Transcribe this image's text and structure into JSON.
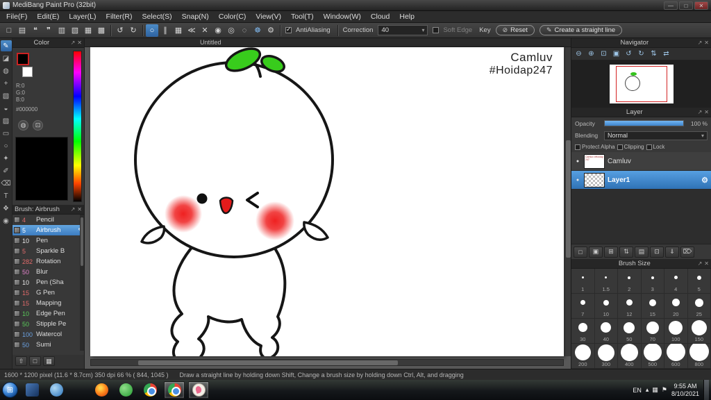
{
  "window": {
    "title": "MediBang Paint Pro (32bit)",
    "minimize": "—",
    "maximize": "□",
    "close": "✕"
  },
  "menubar": [
    "File(F)",
    "Edit(E)",
    "Layer(L)",
    "Filter(R)",
    "Select(S)",
    "Snap(N)",
    "Color(C)",
    "View(V)",
    "Tool(T)",
    "Window(W)",
    "Cloud",
    "Help"
  ],
  "toolbar": {
    "file_icons": [
      {
        "name": "new-canvas-icon",
        "glyph": "□"
      },
      {
        "name": "open-file-icon",
        "glyph": "▤"
      },
      {
        "name": "cloud-upload-icon",
        "glyph": "❝"
      },
      {
        "name": "comment-icon",
        "glyph": "❞"
      },
      {
        "name": "save-icon",
        "glyph": "▥"
      },
      {
        "name": "export-icon",
        "glyph": "▧"
      },
      {
        "name": "resize-canvas-icon",
        "glyph": "▦"
      },
      {
        "name": "crop-canvas-icon",
        "glyph": "▩"
      }
    ],
    "undo_glyph": "↺",
    "redo_glyph": "↻",
    "snap_icons": [
      {
        "name": "freehand-brush-icon",
        "glyph": "○",
        "cls": "selected"
      },
      {
        "name": "snap-parallel-icon",
        "glyph": "∥"
      },
      {
        "name": "snap-grid-icon",
        "glyph": "▦"
      },
      {
        "name": "snap-lines-icon",
        "glyph": "≪"
      },
      {
        "name": "snap-cross-icon",
        "glyph": "✕"
      },
      {
        "name": "snap-vanishing-icon",
        "glyph": "◉"
      },
      {
        "name": "snap-concentric-icon",
        "glyph": "◎"
      },
      {
        "name": "snap-ellipse-icon",
        "glyph": "◌"
      },
      {
        "name": "snap-rotate-icon",
        "glyph": "☸",
        "cls": "blue"
      },
      {
        "name": "snap-settings-icon",
        "glyph": "⚙"
      }
    ],
    "antialiasing_label": "AntiAliasing",
    "correction_label": "Correction",
    "correction_value": "40",
    "dropdown_arrow": "▾",
    "soft_edge_label": "Soft Edge",
    "key_label": "Key",
    "reset_icon": "⊘",
    "reset_label": "Reset",
    "straight_line_icon": "✎",
    "straight_line_label": "Create a straight line"
  },
  "panel_icons": {
    "popout": "↗",
    "close": "✕"
  },
  "tool_strip": [
    {
      "name": "brush-tool-icon",
      "glyph": "✎",
      "cls": "selected"
    },
    {
      "name": "eraser-tool-icon",
      "glyph": "◪"
    },
    {
      "name": "smudge-tool-icon",
      "glyph": "◍"
    },
    {
      "name": "move-tool-icon",
      "glyph": "+"
    },
    {
      "name": "fill-tool-icon",
      "glyph": "▧"
    },
    {
      "name": "bucket-tool-icon",
      "glyph": "◒"
    },
    {
      "name": "gradient-tool-icon",
      "glyph": "▨"
    },
    {
      "name": "select-tool-icon",
      "glyph": "▭"
    },
    {
      "name": "lasso-tool-icon",
      "glyph": "○"
    },
    {
      "name": "magic-wand-tool-icon",
      "glyph": "✦"
    },
    {
      "name": "select-pen-tool-icon",
      "glyph": "✐"
    },
    {
      "name": "select-eraser-tool-icon",
      "glyph": "⌫"
    },
    {
      "name": "text-tool-icon",
      "glyph": "T"
    },
    {
      "name": "pan-tool-icon",
      "glyph": "❖"
    },
    {
      "name": "eyedropper-tool-icon",
      "glyph": "◉"
    }
  ],
  "color_panel": {
    "title": "Color",
    "r_label": "R:0",
    "g_label": "G:0",
    "b_label": "B:0",
    "hex_value": "#000000",
    "wheel_icon": "◍",
    "palette_icon": "⊡"
  },
  "brush_panel": {
    "title": "Brush: Airbrush",
    "brushes": [
      {
        "size": "4",
        "name": "Pencil",
        "color": "#e06a6a"
      },
      {
        "size": "5",
        "name": "Airbrush",
        "color": "#ffffff",
        "cls": "selected",
        "edit": "✎"
      },
      {
        "size": "10",
        "name": "Pen",
        "color": "#e8e8e8"
      },
      {
        "size": "5",
        "name": "Sparkle B",
        "color": "#e06a6a"
      },
      {
        "size": "282",
        "name": "Rotation",
        "color": "#e06a6a"
      },
      {
        "size": "50",
        "name": "Blur",
        "color": "#e080c8"
      },
      {
        "size": "10",
        "name": "Pen (Sha",
        "color": "#e8e8e8"
      },
      {
        "size": "15",
        "name": "G Pen",
        "color": "#e06a6a"
      },
      {
        "size": "15",
        "name": "Mapping",
        "color": "#e06a6a"
      },
      {
        "size": "10",
        "name": "Edge Pen",
        "color": "#58c858"
      },
      {
        "size": "50",
        "name": "Stipple Pe",
        "color": "#58c858"
      },
      {
        "size": "100",
        "name": "Watercol",
        "color": "#6aa0e0"
      },
      {
        "size": "50",
        "name": "Sumi",
        "color": "#6aa0e0"
      }
    ]
  },
  "brush_footer_icons": [
    {
      "name": "sync-brushes-icon",
      "glyph": "⇧"
    },
    {
      "name": "add-brush-icon",
      "glyph": "□"
    },
    {
      "name": "brush-settings-icon",
      "glyph": "▦"
    }
  ],
  "canvas": {
    "tab_title": "Untitled",
    "signature_line1": "Camluv",
    "signature_line2": "#Hoidap247"
  },
  "navigator": {
    "title": "Navigator",
    "icons": [
      {
        "name": "zoom-out-icon",
        "glyph": "⊖"
      },
      {
        "name": "zoom-in-icon",
        "glyph": "⊕"
      },
      {
        "name": "fit-window-icon",
        "glyph": "⊡"
      },
      {
        "name": "actual-pixels-icon",
        "glyph": "▣"
      },
      {
        "name": "rotate-left-icon",
        "glyph": "↺"
      },
      {
        "name": "rotate-right-icon",
        "glyph": "↻"
      },
      {
        "name": "reset-rotation-icon",
        "glyph": "⇅"
      },
      {
        "name": "flip-horizontal-icon",
        "glyph": "⇄"
      }
    ]
  },
  "layer_panel": {
    "title": "Layer",
    "opacity_label": "Opacity",
    "opacity_value": "100 %",
    "blending_label": "Blending",
    "blending_value": "Normal",
    "dropdown_arrow": "▾",
    "protect_alpha_label": "Protect Alpha",
    "clipping_label": "Clipping",
    "lock_label": "Lock",
    "visibility_glyph": "●",
    "settings_glyph": "⚙",
    "layers": [
      {
        "name": "Camluv",
        "thumb_text": "Camluv #Hoidap247"
      },
      {
        "name": "Layer1"
      }
    ],
    "footer_icons": [
      {
        "name": "new-layer-icon",
        "glyph": "□"
      },
      {
        "name": "new-folder-icon",
        "glyph": "▣"
      },
      {
        "name": "duplicate-layer-icon",
        "glyph": "⊞"
      },
      {
        "name": "layer-order-icon",
        "glyph": "⇅"
      },
      {
        "name": "layer-folder-icon",
        "glyph": "▤"
      },
      {
        "name": "copy-layer-icon",
        "glyph": "⊡"
      },
      {
        "name": "merge-layer-icon",
        "glyph": "⇓"
      },
      {
        "name": "delete-layer-icon",
        "glyph": "⌦"
      }
    ]
  },
  "brush_size_panel": {
    "title": "Brush Size",
    "sizes": [
      {
        "label": "1",
        "dot": "3px"
      },
      {
        "label": "1.5",
        "dot": "3px"
      },
      {
        "label": "2",
        "dot": "4px"
      },
      {
        "label": "3",
        "dot": "4px"
      },
      {
        "label": "4",
        "dot": "5px"
      },
      {
        "label": "5",
        "dot": "6px"
      },
      {
        "label": "7",
        "dot": "7px"
      },
      {
        "label": "10",
        "dot": "8px"
      },
      {
        "label": "12",
        "dot": "9px"
      },
      {
        "label": "15",
        "dot": "10px"
      },
      {
        "label": "20",
        "dot": "11px"
      },
      {
        "label": "25",
        "dot": "12px"
      },
      {
        "label": "30",
        "dot": "13px"
      },
      {
        "label": "40",
        "dot": "15px"
      },
      {
        "label": "50",
        "dot": "16px"
      },
      {
        "label": "70",
        "dot": "18px"
      },
      {
        "label": "100",
        "dot": "20px"
      },
      {
        "label": "150",
        "dot": "22px"
      },
      {
        "label": "200",
        "dot": "23px"
      },
      {
        "label": "300",
        "dot": "24px"
      },
      {
        "label": "400",
        "dot": "25px"
      },
      {
        "label": "500",
        "dot": "26px"
      },
      {
        "label": "600",
        "dot": "27px"
      },
      {
        "label": "800",
        "dot": "28px"
      }
    ]
  },
  "statusbar": {
    "info": "1600 * 1200 pixel   (11.6 * 8.7cm)   350 dpi   66 %   ( 844, 1045 )",
    "hint": "Draw a straight line by holding down Shift, Change a brush size by holding down Ctrl, Alt, and dragging"
  },
  "taskbar": {
    "start_glyph": "⊞",
    "tray_lang": "EN",
    "tray_icons": [
      {
        "name": "tray-expand-icon",
        "glyph": "▴"
      },
      {
        "name": "ime-keyboard-icon",
        "glyph": "▦"
      },
      {
        "name": "action-center-flag-icon",
        "glyph": "⚑"
      }
    ],
    "tray_time": "9:55 AM",
    "tray_date": "8/10/2021"
  }
}
